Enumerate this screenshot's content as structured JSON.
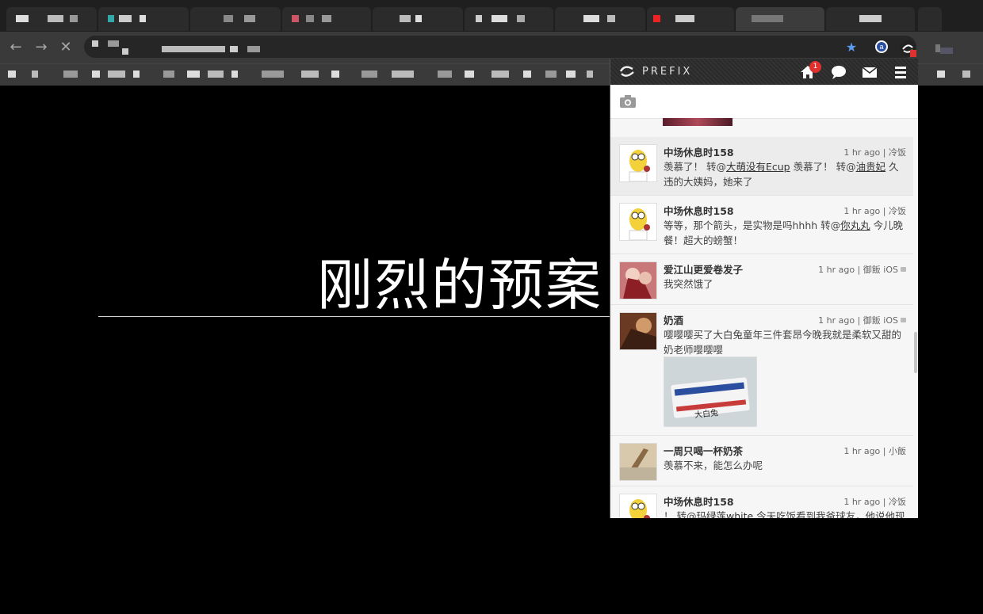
{
  "browser": {
    "tab_count": 11,
    "nav": {
      "back": "←",
      "forward": "→",
      "stop": "✕"
    },
    "omnibox_url": "",
    "toolbar_icons": [
      "bookmark-star-icon",
      "extension-a-icon",
      "prefix-extension-icon",
      "profile-icon"
    ],
    "colors": {
      "star": "#5b9bf0",
      "ext_badge": "#e0312f"
    }
  },
  "page": {
    "heading": "刚烈的预案"
  },
  "popup": {
    "brand": "PREFIX",
    "header_icons": [
      "home-icon",
      "comment-icon",
      "mail-icon",
      "menu-icon"
    ],
    "notification_count": "1",
    "composer_icon": "camera-icon",
    "posts": [
      {
        "user": "中场休息时158",
        "time": "1 hr ago",
        "source": "冷饭",
        "text_parts": [
          "羡慕了！ 转@",
          "大萌没有Ecup",
          " 羡慕了！ 转@",
          "油贵妃",
          " 久违的大姨妈，她来了"
        ],
        "locked": false
      },
      {
        "user": "中场休息时158",
        "time": "1 hr ago",
        "source": "冷饭",
        "text_parts": [
          "等等，那个箭头，是实物是吗hhhh 转@",
          "你丸丸",
          " 今儿晚餐！超大的螃蟹！"
        ],
        "locked": false
      },
      {
        "user": "爱江山更爱卷发子",
        "time": "1 hr ago",
        "source": "御飯 iOS",
        "text_parts": [
          "我突然饿了"
        ],
        "locked": true
      },
      {
        "user": "奶酒",
        "time": "1 hr ago",
        "source": "御飯 iOS",
        "text_parts": [
          "嘤嘤嘤买了大白兔童年三件套昂今晚我就是柔软又甜的奶老师嘤嘤嘤"
        ],
        "locked": true,
        "image_label": "大白兔"
      },
      {
        "user": "一周只喝一杯奶茶",
        "time": "1 hr ago",
        "source": "小飯",
        "text_parts": [
          "羡慕不来，能怎么办呢"
        ],
        "locked": false
      },
      {
        "user": "中场休息时158",
        "time": "1 hr ago",
        "source": "冷饭",
        "text_parts": [
          "！ 转@",
          "玛绿莲white",
          " 今天吃饭看到我爸球友，他说他现"
        ],
        "locked": false
      }
    ]
  }
}
